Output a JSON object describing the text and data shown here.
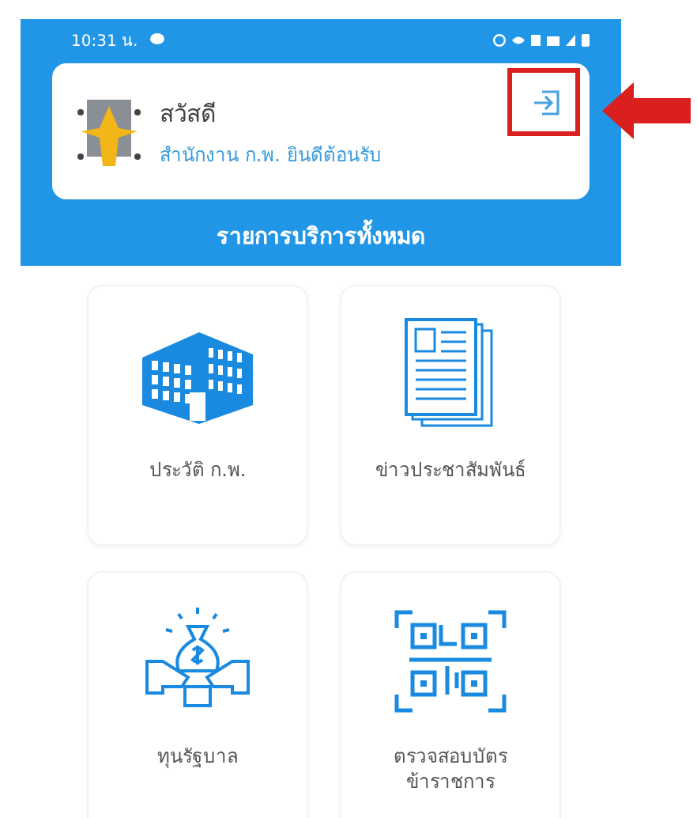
{
  "status_bar": {
    "time": "10:31 น."
  },
  "header": {
    "greeting": "สวัสดี",
    "welcome": "สำนักงาน ก.พ. ยินดีต้อนรับ",
    "section_title": "รายการบริการทั้งหมด"
  },
  "services": [
    {
      "kind": "building",
      "label": "ประวัติ ก.พ."
    },
    {
      "kind": "newspaper",
      "label": "ข่าวประชาสัมพันธ์"
    },
    {
      "kind": "money",
      "label": "ทุนรัฐบาล"
    },
    {
      "kind": "qr",
      "label": "ตรวจสอบบัตรข้าราชการ"
    }
  ]
}
